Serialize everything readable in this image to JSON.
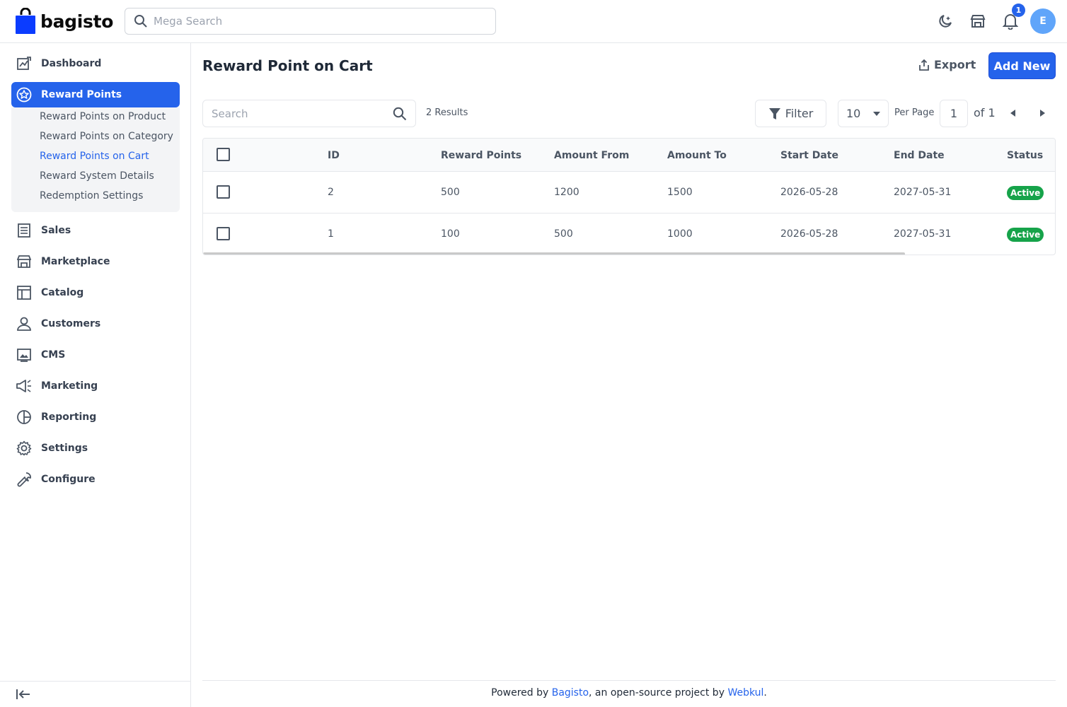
{
  "header": {
    "logo_text": "bagisto",
    "search_placeholder": "Mega Search",
    "notification_count": "1",
    "avatar_initial": "E"
  },
  "sidebar": {
    "items": [
      {
        "label": "Dashboard",
        "icon": "dashboard-icon"
      },
      {
        "label": "Reward Points",
        "icon": "star-icon",
        "active": true
      },
      {
        "label": "Sales",
        "icon": "sales-icon"
      },
      {
        "label": "Marketplace",
        "icon": "store-icon"
      },
      {
        "label": "Catalog",
        "icon": "catalog-icon"
      },
      {
        "label": "Customers",
        "icon": "user-icon"
      },
      {
        "label": "CMS",
        "icon": "cms-icon"
      },
      {
        "label": "Marketing",
        "icon": "megaphone-icon"
      },
      {
        "label": "Reporting",
        "icon": "chart-icon"
      },
      {
        "label": "Settings",
        "icon": "gear-icon"
      },
      {
        "label": "Configure",
        "icon": "wrench-icon"
      }
    ],
    "sub_items": [
      {
        "label": "Reward Points on Product"
      },
      {
        "label": "Reward Points on Category"
      },
      {
        "label": "Reward Points on Cart",
        "active": true
      },
      {
        "label": "Reward System Details"
      },
      {
        "label": "Redemption Settings"
      }
    ]
  },
  "main": {
    "title": "Reward Point on Cart",
    "export_label": "Export",
    "add_new_label": "Add New",
    "search_placeholder": "Search",
    "results_text": "2 Results",
    "filter_label": "Filter",
    "per_page_value": "10",
    "per_page_label": "Per Page",
    "page_value": "1",
    "page_of": "of 1"
  },
  "table": {
    "columns": [
      "ID",
      "Reward Points",
      "Amount From",
      "Amount To",
      "Start Date",
      "End Date",
      "Status"
    ],
    "rows": [
      {
        "id": "2",
        "reward_points": "500",
        "amount_from": "1200",
        "amount_to": "1500",
        "start_date": "2026-05-28",
        "end_date": "2027-05-31",
        "status": "Active"
      },
      {
        "id": "1",
        "reward_points": "100",
        "amount_from": "500",
        "amount_to": "1000",
        "start_date": "2026-05-28",
        "end_date": "2027-05-31",
        "status": "Active"
      }
    ]
  },
  "footer": {
    "prefix": "Powered by ",
    "link1": "Bagisto",
    "middle": ", an open-source project by ",
    "link2": "Webkul",
    "suffix": "."
  },
  "colors": {
    "accent": "#2563eb",
    "status_active": "#16a34a"
  }
}
